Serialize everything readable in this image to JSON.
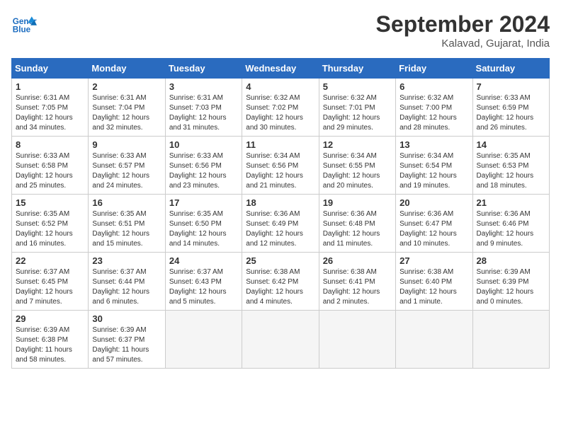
{
  "header": {
    "logo_line1": "General",
    "logo_line2": "Blue",
    "month": "September 2024",
    "location": "Kalavad, Gujarat, India"
  },
  "days_of_week": [
    "Sunday",
    "Monday",
    "Tuesday",
    "Wednesday",
    "Thursday",
    "Friday",
    "Saturday"
  ],
  "weeks": [
    [
      {
        "day": "1",
        "sunrise": "6:31 AM",
        "sunset": "7:05 PM",
        "daylight": "12 hours and 34 minutes."
      },
      {
        "day": "2",
        "sunrise": "6:31 AM",
        "sunset": "7:04 PM",
        "daylight": "12 hours and 32 minutes."
      },
      {
        "day": "3",
        "sunrise": "6:31 AM",
        "sunset": "7:03 PM",
        "daylight": "12 hours and 31 minutes."
      },
      {
        "day": "4",
        "sunrise": "6:32 AM",
        "sunset": "7:02 PM",
        "daylight": "12 hours and 30 minutes."
      },
      {
        "day": "5",
        "sunrise": "6:32 AM",
        "sunset": "7:01 PM",
        "daylight": "12 hours and 29 minutes."
      },
      {
        "day": "6",
        "sunrise": "6:32 AM",
        "sunset": "7:00 PM",
        "daylight": "12 hours and 28 minutes."
      },
      {
        "day": "7",
        "sunrise": "6:33 AM",
        "sunset": "6:59 PM",
        "daylight": "12 hours and 26 minutes."
      }
    ],
    [
      {
        "day": "8",
        "sunrise": "6:33 AM",
        "sunset": "6:58 PM",
        "daylight": "12 hours and 25 minutes."
      },
      {
        "day": "9",
        "sunrise": "6:33 AM",
        "sunset": "6:57 PM",
        "daylight": "12 hours and 24 minutes."
      },
      {
        "day": "10",
        "sunrise": "6:33 AM",
        "sunset": "6:56 PM",
        "daylight": "12 hours and 23 minutes."
      },
      {
        "day": "11",
        "sunrise": "6:34 AM",
        "sunset": "6:56 PM",
        "daylight": "12 hours and 21 minutes."
      },
      {
        "day": "12",
        "sunrise": "6:34 AM",
        "sunset": "6:55 PM",
        "daylight": "12 hours and 20 minutes."
      },
      {
        "day": "13",
        "sunrise": "6:34 AM",
        "sunset": "6:54 PM",
        "daylight": "12 hours and 19 minutes."
      },
      {
        "day": "14",
        "sunrise": "6:35 AM",
        "sunset": "6:53 PM",
        "daylight": "12 hours and 18 minutes."
      }
    ],
    [
      {
        "day": "15",
        "sunrise": "6:35 AM",
        "sunset": "6:52 PM",
        "daylight": "12 hours and 16 minutes."
      },
      {
        "day": "16",
        "sunrise": "6:35 AM",
        "sunset": "6:51 PM",
        "daylight": "12 hours and 15 minutes."
      },
      {
        "day": "17",
        "sunrise": "6:35 AM",
        "sunset": "6:50 PM",
        "daylight": "12 hours and 14 minutes."
      },
      {
        "day": "18",
        "sunrise": "6:36 AM",
        "sunset": "6:49 PM",
        "daylight": "12 hours and 12 minutes."
      },
      {
        "day": "19",
        "sunrise": "6:36 AM",
        "sunset": "6:48 PM",
        "daylight": "12 hours and 11 minutes."
      },
      {
        "day": "20",
        "sunrise": "6:36 AM",
        "sunset": "6:47 PM",
        "daylight": "12 hours and 10 minutes."
      },
      {
        "day": "21",
        "sunrise": "6:36 AM",
        "sunset": "6:46 PM",
        "daylight": "12 hours and 9 minutes."
      }
    ],
    [
      {
        "day": "22",
        "sunrise": "6:37 AM",
        "sunset": "6:45 PM",
        "daylight": "12 hours and 7 minutes."
      },
      {
        "day": "23",
        "sunrise": "6:37 AM",
        "sunset": "6:44 PM",
        "daylight": "12 hours and 6 minutes."
      },
      {
        "day": "24",
        "sunrise": "6:37 AM",
        "sunset": "6:43 PM",
        "daylight": "12 hours and 5 minutes."
      },
      {
        "day": "25",
        "sunrise": "6:38 AM",
        "sunset": "6:42 PM",
        "daylight": "12 hours and 4 minutes."
      },
      {
        "day": "26",
        "sunrise": "6:38 AM",
        "sunset": "6:41 PM",
        "daylight": "12 hours and 2 minutes."
      },
      {
        "day": "27",
        "sunrise": "6:38 AM",
        "sunset": "6:40 PM",
        "daylight": "12 hours and 1 minute."
      },
      {
        "day": "28",
        "sunrise": "6:39 AM",
        "sunset": "6:39 PM",
        "daylight": "12 hours and 0 minutes."
      }
    ],
    [
      {
        "day": "29",
        "sunrise": "6:39 AM",
        "sunset": "6:38 PM",
        "daylight": "11 hours and 58 minutes."
      },
      {
        "day": "30",
        "sunrise": "6:39 AM",
        "sunset": "6:37 PM",
        "daylight": "11 hours and 57 minutes."
      },
      null,
      null,
      null,
      null,
      null
    ]
  ]
}
